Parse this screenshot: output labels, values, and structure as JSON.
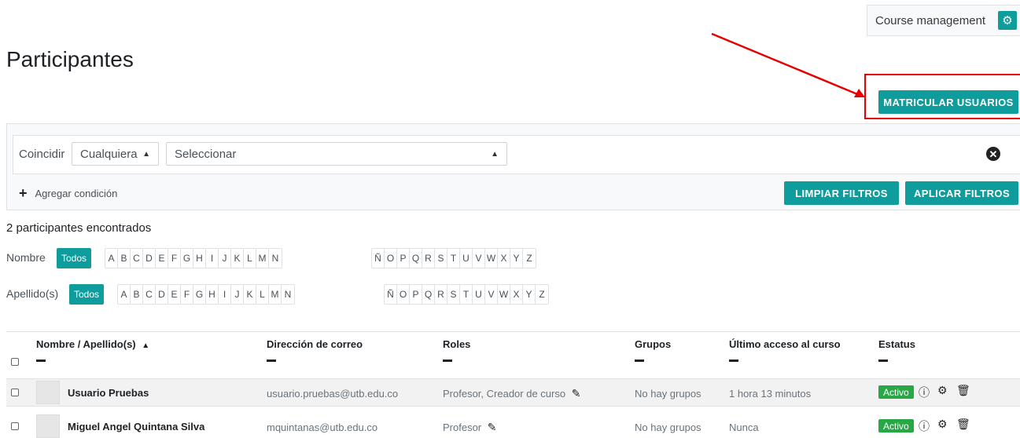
{
  "header": {
    "course_management": "Course management",
    "page_title": "Participantes",
    "enrol_button": "MATRICULAR USUARIOS"
  },
  "filter": {
    "match_label": "Coincidir",
    "match_value": "Cualquiera",
    "field_value": "Seleccionar",
    "add_condition": "Agregar condición",
    "clear_button": "LIMPIAR FILTROS",
    "apply_button": "APLICAR FILTROS"
  },
  "results": {
    "count_text": "2 participantes encontrados"
  },
  "initials": {
    "first_label": "Nombre",
    "last_label": "Apellido(s)",
    "all_label": "Todos",
    "group1": [
      "A",
      "B",
      "C",
      "D",
      "E",
      "F",
      "G",
      "H",
      "I",
      "J",
      "K",
      "L",
      "M",
      "N"
    ],
    "group2": [
      "Ñ",
      "O",
      "P",
      "Q",
      "R",
      "S",
      "T",
      "U",
      "V",
      "W",
      "X",
      "Y",
      "Z"
    ]
  },
  "table": {
    "headers": {
      "name": "Nombre / Apellido(s)",
      "email": "Dirección de correo",
      "roles": "Roles",
      "groups": "Grupos",
      "last_access": "Último acceso al curso",
      "status": "Estatus"
    },
    "rows": [
      {
        "name": "Usuario Pruebas",
        "email": "usuario.pruebas@utb.edu.co",
        "roles": "Profesor, Creador de curso",
        "groups": "No hay grupos",
        "last_access": "1 hora 13 minutos",
        "status": "Activo"
      },
      {
        "name": "Miguel Angel Quintana Silva",
        "email": "mquintanas@utb.edu.co",
        "roles": "Profesor",
        "groups": "No hay grupos",
        "last_access": "Nunca",
        "status": "Activo"
      }
    ]
  },
  "colors": {
    "accent": "#0f9c9c",
    "status_active": "#28a745",
    "annotation": "#e60000"
  }
}
